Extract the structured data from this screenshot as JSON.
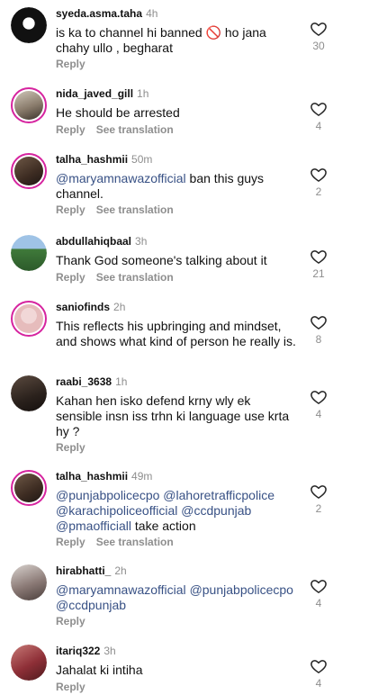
{
  "comments": [
    {
      "user": "syeda.asma.taha",
      "time": "4h",
      "parts": [
        {
          "t": "is ka to channel hi banned 🚫 ho jana chahy ullo , begharat",
          "m": false
        }
      ],
      "reply": "Reply",
      "translate": "",
      "likes": "30"
    },
    {
      "user": "nida_javed_gill",
      "time": "1h",
      "parts": [
        {
          "t": "He should be arrested",
          "m": false
        }
      ],
      "reply": "Reply",
      "translate": "See translation",
      "likes": "4"
    },
    {
      "user": "talha_hashmii",
      "time": "50m",
      "parts": [
        {
          "t": "@maryamnawazofficial",
          "m": true
        },
        {
          "t": " ban this guys channel.",
          "m": false
        }
      ],
      "reply": "Reply",
      "translate": "See translation",
      "likes": "2"
    },
    {
      "user": "abdullahiqbaal",
      "time": "3h",
      "parts": [
        {
          "t": "Thank God someone's talking about it",
          "m": false
        }
      ],
      "reply": "Reply",
      "translate": "See translation",
      "likes": "21"
    },
    {
      "user": "saniofinds",
      "time": "2h",
      "parts": [
        {
          "t": "This reflects his upbringing and mindset, and shows what kind of person he really is.",
          "m": false
        }
      ],
      "reply": "",
      "translate": "",
      "likes": "8"
    },
    {
      "user": "raabi_3638",
      "time": "1h",
      "parts": [
        {
          "t": "Kahan hen isko defend krny wly ek sensible insn iss trhn ki language use krta hy ?",
          "m": false
        }
      ],
      "reply": "Reply",
      "translate": "",
      "likes": "4"
    },
    {
      "user": "talha_hashmii",
      "time": "49m",
      "parts": [
        {
          "t": "@punjabpolicecpo",
          "m": true
        },
        {
          "t": " ",
          "m": false
        },
        {
          "t": "@lahoretrafficpolice",
          "m": true
        },
        {
          "t": " ",
          "m": false
        },
        {
          "t": "@karachipoliceofficial",
          "m": true
        },
        {
          "t": " ",
          "m": false
        },
        {
          "t": "@ccdpunjab",
          "m": true
        },
        {
          "t": " ",
          "m": false
        },
        {
          "t": "@pmaofficiall",
          "m": true
        },
        {
          "t": "  take action",
          "m": false
        }
      ],
      "reply": "Reply",
      "translate": "See translation",
      "likes": "2"
    },
    {
      "user": "hirabhatti_",
      "time": "2h",
      "parts": [
        {
          "t": "@maryamnawazofficial",
          "m": true
        },
        {
          "t": " ",
          "m": false
        },
        {
          "t": "@punjabpolicecpo",
          "m": true
        },
        {
          "t": " ",
          "m": false
        },
        {
          "t": "@ccdpunjab",
          "m": true
        }
      ],
      "reply": "Reply",
      "translate": "",
      "likes": "4"
    },
    {
      "user": "itariq322",
      "time": "3h",
      "parts": [
        {
          "t": "Jahalat ki intiha",
          "m": false
        }
      ],
      "reply": "Reply",
      "translate": "",
      "likes": "4"
    }
  ],
  "icons": {
    "like": "heart-outline-icon",
    "avatar": "user-avatar"
  },
  "colors": {
    "mention": "#385185",
    "muted": "#8e8e8e",
    "story_ring": "#d6249f"
  }
}
